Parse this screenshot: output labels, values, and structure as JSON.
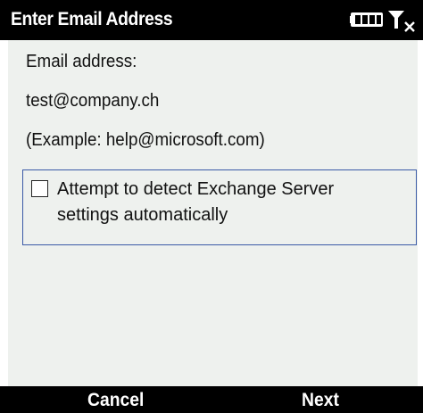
{
  "title_bar": {
    "title": "Enter Email Address",
    "icons": [
      "battery-icon",
      "signal-no-service-icon"
    ]
  },
  "form": {
    "email_label": "Email address:",
    "email_value": "test@company.ch",
    "example_hint": "(Example: help@microsoft.com)",
    "detect_checkbox": {
      "checked": false,
      "label_line1": "Attempt to detect Exchange Server",
      "label_line2": "settings automatically"
    }
  },
  "softkeys": {
    "left_label": "Cancel",
    "right_label": "Next"
  },
  "colors": {
    "bar_bg": "#000000",
    "bar_text": "#ffffff",
    "content_bg": "#eef1ee",
    "focus_border": "#3a5aa6"
  }
}
